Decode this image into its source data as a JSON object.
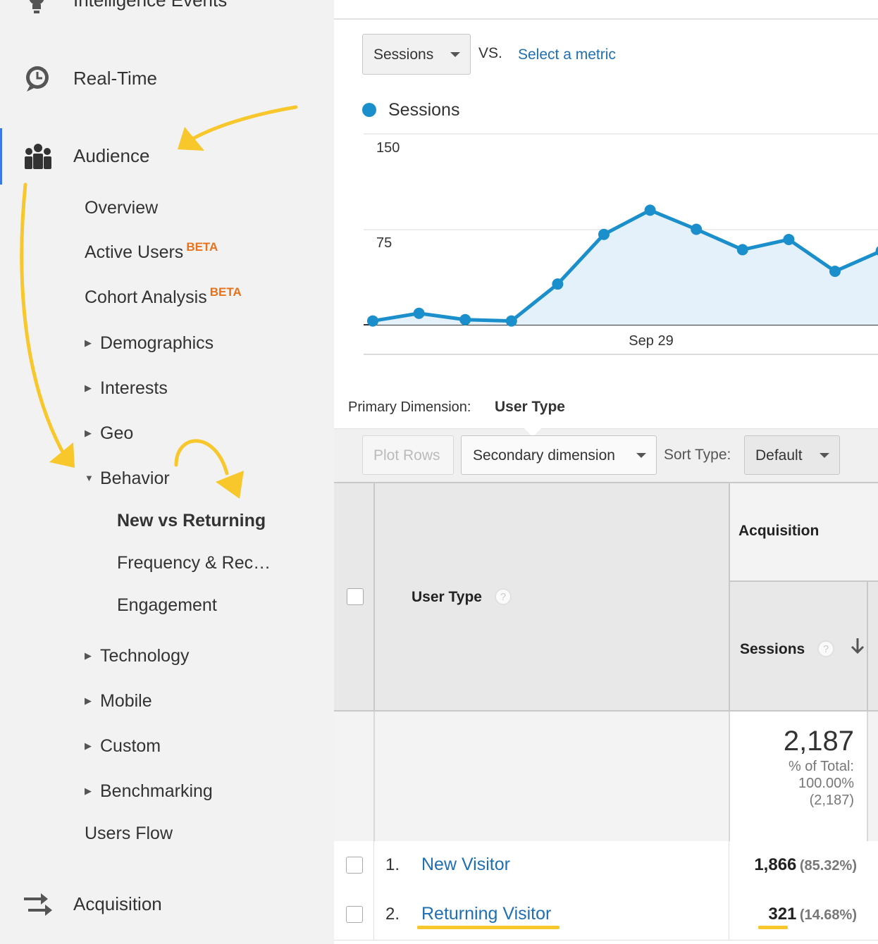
{
  "sidebar": {
    "top_items": [
      {
        "label": "Intelligence Events",
        "icon": "lightbulb-icon"
      },
      {
        "label": "Real-Time",
        "icon": "clock-icon"
      },
      {
        "label": "Audience",
        "icon": "people-icon"
      },
      {
        "label": "Acquisition",
        "icon": "acquisition-arrows-icon"
      }
    ],
    "audience_items": [
      {
        "label": "Overview"
      },
      {
        "label": "Active Users",
        "badge": "BETA"
      },
      {
        "label": "Cohort Analysis",
        "badge": "BETA"
      },
      {
        "label": "Demographics"
      },
      {
        "label": "Interests"
      },
      {
        "label": "Geo"
      },
      {
        "label": "Behavior"
      },
      {
        "label": "Technology"
      },
      {
        "label": "Mobile"
      },
      {
        "label": "Custom"
      },
      {
        "label": "Benchmarking"
      },
      {
        "label": "Users Flow"
      }
    ],
    "behavior_items": [
      {
        "label": "New vs Returning"
      },
      {
        "label": "Frequency & Rec…"
      },
      {
        "label": "Engagement"
      }
    ]
  },
  "metric_selector": {
    "selected": "Sessions",
    "vs_label": "VS.",
    "select_metric_link": "Select a metric"
  },
  "chart_data": {
    "type": "area",
    "series": [
      {
        "name": "Sessions",
        "values": [
          3,
          9,
          4,
          3,
          32,
          71,
          90,
          75,
          59,
          67,
          42,
          58
        ]
      }
    ],
    "y_ticks": [
      150,
      75
    ],
    "x_tick_label": "Sep 29",
    "ylim": [
      0,
      150
    ],
    "color": "#1a8fcb",
    "grid": true
  },
  "dimension": {
    "label": "Primary Dimension:",
    "value": "User Type"
  },
  "toolbar": {
    "plot_rows": "Plot Rows",
    "secondary_dimension": "Secondary dimension",
    "sort_type_label": "Sort Type:",
    "sort_type_value": "Default"
  },
  "table": {
    "group_header": "Acquisition",
    "col_user_type": "User Type",
    "col_sessions": "Sessions",
    "sort_icon": "arrow-down-icon",
    "total": {
      "value": "2,187",
      "pct_label": "% of Total:",
      "pct_value": "100.00%",
      "pct_abs": "(2,187)"
    },
    "rows": [
      {
        "index": "1.",
        "name": "New Visitor",
        "sessions": "1,866",
        "pct": "(85.32%)"
      },
      {
        "index": "2.",
        "name": "Returning Visitor",
        "sessions": "321",
        "pct": "(14.68%)"
      }
    ]
  },
  "colors": {
    "accent": "#1a8fcb",
    "link": "#1e6fb3",
    "beta": "#e8711a",
    "annotation": "#f7c72c",
    "active_bar": "#3b78e7"
  }
}
